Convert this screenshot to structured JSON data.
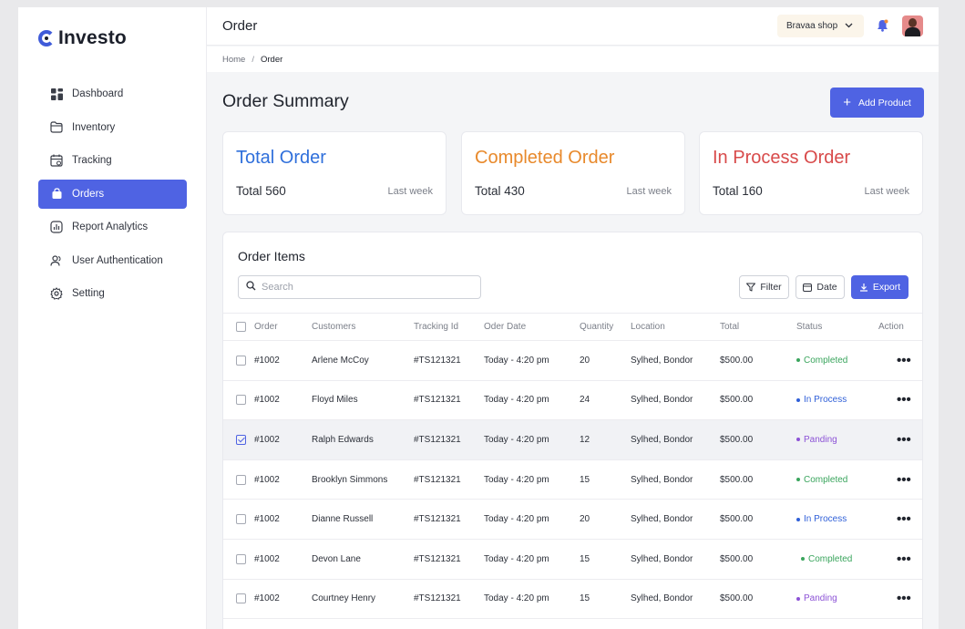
{
  "brand": {
    "name": "Investo",
    "accent": "#4f63e3"
  },
  "sidebar": {
    "items": [
      {
        "label": "Dashboard",
        "icon": "grid-icon"
      },
      {
        "label": "Inventory",
        "icon": "folder-icon"
      },
      {
        "label": "Tracking",
        "icon": "calendar-icon"
      },
      {
        "label": "Orders",
        "icon": "bag-icon",
        "active": true
      },
      {
        "label": "Report Analytics",
        "icon": "chart-icon"
      },
      {
        "label": "User Authentication",
        "icon": "users-icon"
      },
      {
        "label": "Setting",
        "icon": "gear-icon"
      }
    ]
  },
  "topbar": {
    "title": "Order",
    "shop": "Bravaa shop"
  },
  "breadcrumb": {
    "home": "Home",
    "separator": "/",
    "current": "Order"
  },
  "page": {
    "title": "Order Summary",
    "add_label": "Add Product"
  },
  "cards": [
    {
      "title": "Total Order",
      "total": "Total 560",
      "period": "Last week",
      "color": "#2f6fdb"
    },
    {
      "title": "Completed Order",
      "total": "Total 430",
      "period": "Last week",
      "color": "#e8892b"
    },
    {
      "title": "In Process Order",
      "total": "Total 160",
      "period": "Last week",
      "color": "#d84a4a"
    }
  ],
  "order_items": {
    "title": "Order Items",
    "search_placeholder": "Search",
    "filter_label": "Filter",
    "date_label": "Date",
    "export_label": "Export",
    "columns": [
      "Order",
      "Customers",
      "Tracking Id",
      "Oder Date",
      "Quantity",
      "Location",
      "Total",
      "Status",
      "Action"
    ],
    "rows": [
      {
        "order": "#1002",
        "customer": "Arlene McCoy",
        "tracking": "#TS121321",
        "date": "Today - 4:20 pm",
        "qty": "20",
        "location": "Sylhed, Bondor",
        "total": "$500.00",
        "status": "Completed",
        "checked": false
      },
      {
        "order": "#1002",
        "customer": "Floyd Miles",
        "tracking": "#TS121321",
        "date": "Today - 4:20 pm",
        "qty": "24",
        "location": "Sylhed, Bondor",
        "total": "$500.00",
        "status": "In Process",
        "checked": false
      },
      {
        "order": "#1002",
        "customer": "Ralph Edwards",
        "tracking": "#TS121321",
        "date": "Today - 4:20 pm",
        "qty": "12",
        "location": "Sylhed, Bondor",
        "total": "$500.00",
        "status": "Panding",
        "checked": true
      },
      {
        "order": "#1002",
        "customer": "Brooklyn Simmons",
        "tracking": "#TS121321",
        "date": "Today - 4:20 pm",
        "qty": "15",
        "location": "Sylhed, Bondor",
        "total": "$500.00",
        "status": "Completed",
        "checked": false
      },
      {
        "order": "#1002",
        "customer": "Dianne Russell",
        "tracking": "#TS121321",
        "date": "Today - 4:20 pm",
        "qty": "20",
        "location": "Sylhed, Bondor",
        "total": "$500.00",
        "status": "In Process",
        "checked": false
      },
      {
        "order": "#1002",
        "customer": "Devon Lane",
        "tracking": "#TS121321",
        "date": "Today - 4:20 pm",
        "qty": "15",
        "location": "Sylhed, Bondor",
        "total": "$500.00",
        "status": "Completed",
        "checked": false
      },
      {
        "order": "#1002",
        "customer": "Courtney Henry",
        "tracking": "#TS121321",
        "date": "Today - 4:20 pm",
        "qty": "15",
        "location": "Sylhed, Bondor",
        "total": "$500.00",
        "status": "Panding",
        "checked": false
      }
    ],
    "status_colors": {
      "Completed": "#3aa55d",
      "In Process": "#2f5fd8",
      "Panding": "#8c52d6"
    }
  }
}
